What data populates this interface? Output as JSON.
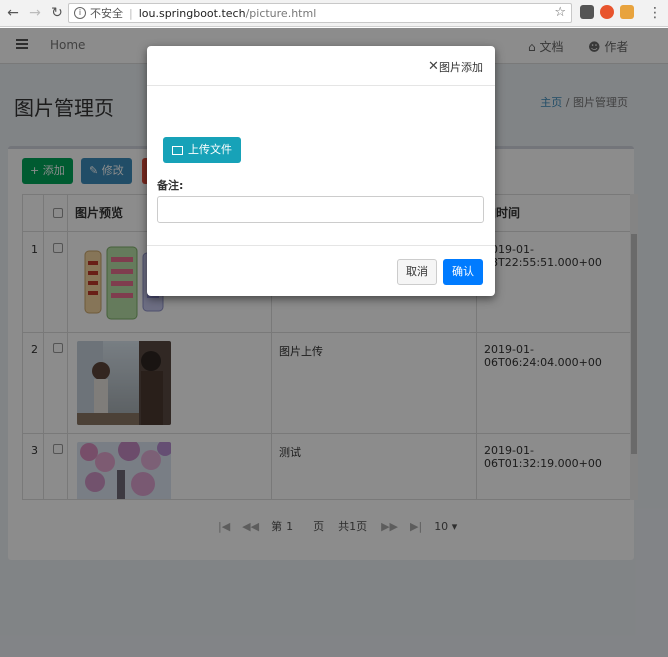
{
  "browser": {
    "insecure_label": "不安全",
    "url_host": "lou.springboot.tech",
    "url_path": "/picture.html"
  },
  "topbar": {
    "home": "Home",
    "docs": "文档",
    "author": "作者"
  },
  "page": {
    "title": "图片管理页",
    "breadcrumb_home": "主页",
    "breadcrumb_sep": "/",
    "breadcrumb_current": "图片管理页"
  },
  "toolbar": {
    "add": "添加",
    "edit": "修改"
  },
  "grid": {
    "headers": [
      "图片预览",
      "",
      "加时间"
    ],
    "rows": [
      {
        "num": "1",
        "remark": "",
        "time": "2019-01-08T22:55:51.000+00"
      },
      {
        "num": "2",
        "remark": "图片上传",
        "time": "2019-01-06T06:24:04.000+00"
      },
      {
        "num": "3",
        "remark": "测试",
        "time": "2019-01-06T01:32:19.000+00"
      }
    ]
  },
  "pager": {
    "page_prefix": "第",
    "page_value": "1",
    "page_suffix": "页",
    "total": "共1页",
    "page_size": "10"
  },
  "modal": {
    "title": "图片添加",
    "upload": "上传文件",
    "note_label": "备注:",
    "note_value": "",
    "cancel": "取消",
    "confirm": "确认"
  },
  "colors": {
    "upload_button": "#17a2b8",
    "confirm_button": "#007bff",
    "add_button": "#00a65a",
    "edit_button": "#3c8dbc",
    "delete_button": "#dd4b39",
    "breadcrumb_link": "#3c8dbc"
  }
}
